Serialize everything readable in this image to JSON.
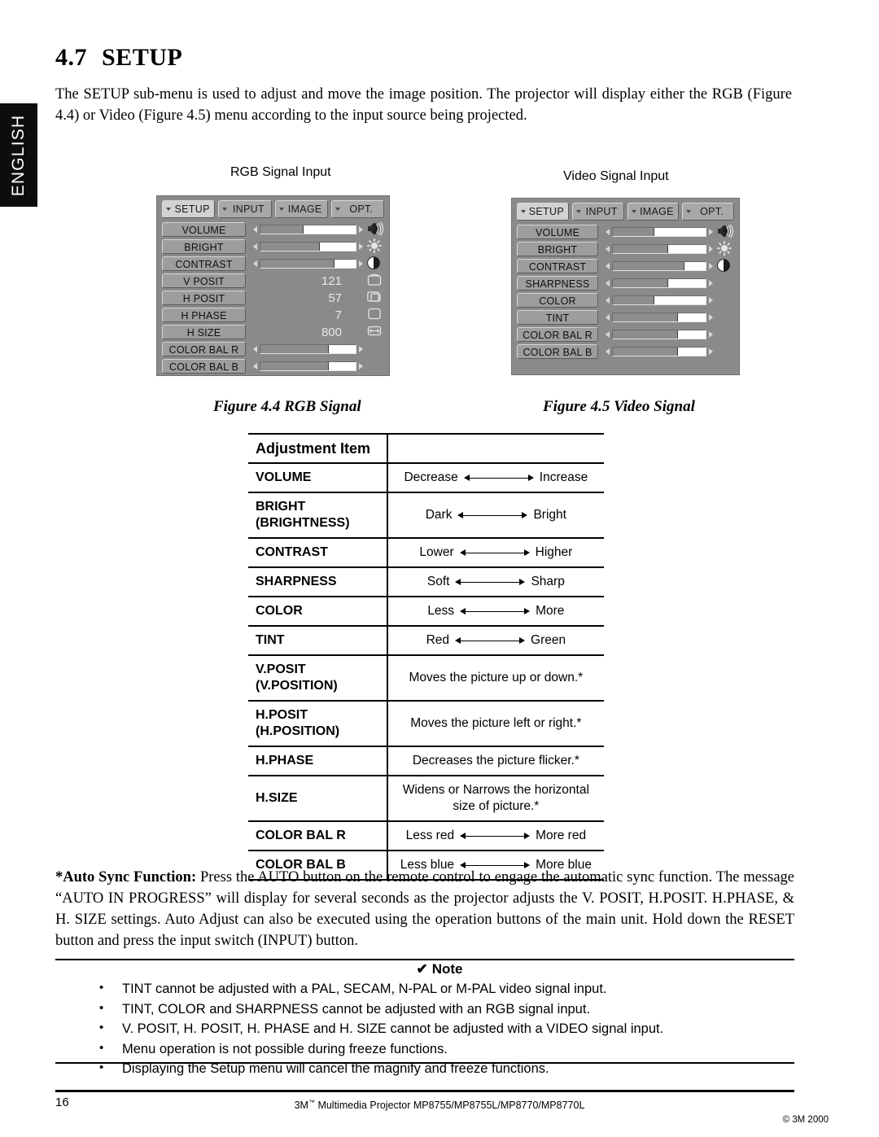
{
  "sidebar": {
    "language_tab": "ENGLISH"
  },
  "section": {
    "number": "4.7",
    "title": "SETUP",
    "intro": "The SETUP sub-menu is used to adjust and move the image position. The projector will display either the RGB (Figure 4.4) or Video (Figure 4.5) menu according to the input source being projected."
  },
  "osd": {
    "rgb": {
      "caption": "RGB Signal Input",
      "figure_caption": "Figure 4.4  RGB Signal",
      "tabs": [
        {
          "label": "SETUP",
          "active": true
        },
        {
          "label": "INPUT",
          "active": false
        },
        {
          "label": "IMAGE",
          "active": false
        },
        {
          "label": "OPT.",
          "active": false
        }
      ],
      "rows": [
        {
          "label": "VOLUME",
          "type": "slider",
          "fill": 45,
          "icon": "speaker-icon"
        },
        {
          "label": "BRIGHT",
          "type": "slider",
          "fill": 62,
          "icon": "sun-icon"
        },
        {
          "label": "CONTRAST",
          "type": "slider",
          "fill": 78,
          "icon": "contrast-icon"
        },
        {
          "label": "V POSIT",
          "type": "value",
          "value": "121",
          "icon": "v-posit-icon"
        },
        {
          "label": "H POSIT",
          "type": "value",
          "value": "57",
          "icon": "h-posit-icon"
        },
        {
          "label": "H PHASE",
          "type": "value",
          "value": "7",
          "icon": "h-phase-icon"
        },
        {
          "label": "H SIZE",
          "type": "value",
          "value": "800",
          "icon": "h-size-icon"
        },
        {
          "label": "COLOR BAL R",
          "type": "slider",
          "fill": 72,
          "icon": "none"
        },
        {
          "label": "COLOR BAL B",
          "type": "slider",
          "fill": 72,
          "icon": "none"
        }
      ]
    },
    "video": {
      "caption": "Video Signal Input",
      "figure_caption": "Figure 4.5  Video Signal",
      "tabs": [
        {
          "label": "SETUP",
          "active": true
        },
        {
          "label": "INPUT",
          "active": false
        },
        {
          "label": "IMAGE",
          "active": false
        },
        {
          "label": "OPT.",
          "active": false
        }
      ],
      "rows": [
        {
          "label": "VOLUME",
          "type": "slider",
          "fill": 45,
          "icon": "speaker-icon"
        },
        {
          "label": "BRIGHT",
          "type": "slider",
          "fill": 60,
          "icon": "sun-icon"
        },
        {
          "label": "CONTRAST",
          "type": "slider",
          "fill": 77,
          "icon": "contrast-icon"
        },
        {
          "label": "SHARPNESS",
          "type": "slider",
          "fill": 60,
          "icon": "none"
        },
        {
          "label": "COLOR",
          "type": "slider",
          "fill": 45,
          "icon": "none"
        },
        {
          "label": "TINT",
          "type": "slider",
          "fill": 70,
          "icon": "none"
        },
        {
          "label": "COLOR BAL R",
          "type": "slider",
          "fill": 70,
          "icon": "none"
        },
        {
          "label": "COLOR BAL B",
          "type": "slider",
          "fill": 70,
          "icon": "none"
        }
      ]
    }
  },
  "table": {
    "header": {
      "col1": "Adjustment Item",
      "col2": ""
    },
    "rows": [
      {
        "item": "VOLUME",
        "item2": "",
        "kind": "range",
        "left": "Decrease",
        "right": "Increase"
      },
      {
        "item": "BRIGHT",
        "item2": "(BRIGHTNESS)",
        "kind": "range",
        "left": "Dark",
        "right": "Bright"
      },
      {
        "item": "CONTRAST",
        "item2": "",
        "kind": "range",
        "left": "Lower",
        "right": "Higher"
      },
      {
        "item": "SHARPNESS",
        "item2": "",
        "kind": "range",
        "left": "Soft",
        "right": "Sharp"
      },
      {
        "item": "COLOR",
        "item2": "",
        "kind": "range",
        "left": "Less",
        "right": "More"
      },
      {
        "item": "TINT",
        "item2": "",
        "kind": "range",
        "left": "Red",
        "right": "Green"
      },
      {
        "item": "V.POSIT",
        "item2": "(V.POSITION)",
        "kind": "text",
        "text": "Moves the picture up or down.*"
      },
      {
        "item": "H.POSIT",
        "item2": "(H.POSITION)",
        "kind": "text",
        "text": "Moves the picture left or right.*"
      },
      {
        "item": "H.PHASE",
        "item2": "",
        "kind": "text",
        "text": "Decreases the picture flicker.*"
      },
      {
        "item": "H.SIZE",
        "item2": "",
        "kind": "text",
        "text": "Widens or Narrows the horizontal size of picture.*"
      },
      {
        "item": "COLOR BAL R",
        "item2": "",
        "kind": "range",
        "left": "Less red",
        "right": "More red"
      },
      {
        "item": "COLOR BAL B",
        "item2": "",
        "kind": "range",
        "left": "Less blue",
        "right": "More blue"
      }
    ]
  },
  "auto_sync": {
    "label": "*Auto Sync Function:",
    "body": " Press the AUTO button on the remote control to engage the automatic sync function. The message “AUTO IN PROGRESS” will display for several seconds as the projector adjusts the V. POSIT, H.POSIT. H.PHASE, & H. SIZE settings. Auto Adjust can also be executed using the operation buttons of the main unit. Hold down the RESET button and press the input switch (INPUT) button."
  },
  "note": {
    "check": "✔",
    "title": "Note",
    "items": [
      "TINT cannot be adjusted with a PAL, SECAM, N-PAL or M-PAL video signal input.",
      "TINT, COLOR and SHARPNESS cannot be adjusted with an RGB signal input.",
      "V. POSIT, H. POSIT, H. PHASE and H. SIZE cannot be adjusted with a VIDEO signal input.",
      "Menu operation is not possible during freeze functions.",
      "Displaying the Setup menu will cancel the magnify and freeze functions."
    ]
  },
  "footer": {
    "page_number": "16",
    "product_prefix": "3M",
    "product_tm": "™",
    "product_suffix": " Multimedia Projector MP8755/MP8755L/MP8770/MP8770L",
    "copyright": "© 3M 2000"
  },
  "colors": {
    "osd_panel": "#8a8a8a",
    "osd_button": "#9d9d9d",
    "osd_tab_active": "#d2d2d2",
    "slider_fill": "#8d8d8d",
    "slider_track": "#ffffff",
    "tab_black": "#0d0d0d"
  }
}
